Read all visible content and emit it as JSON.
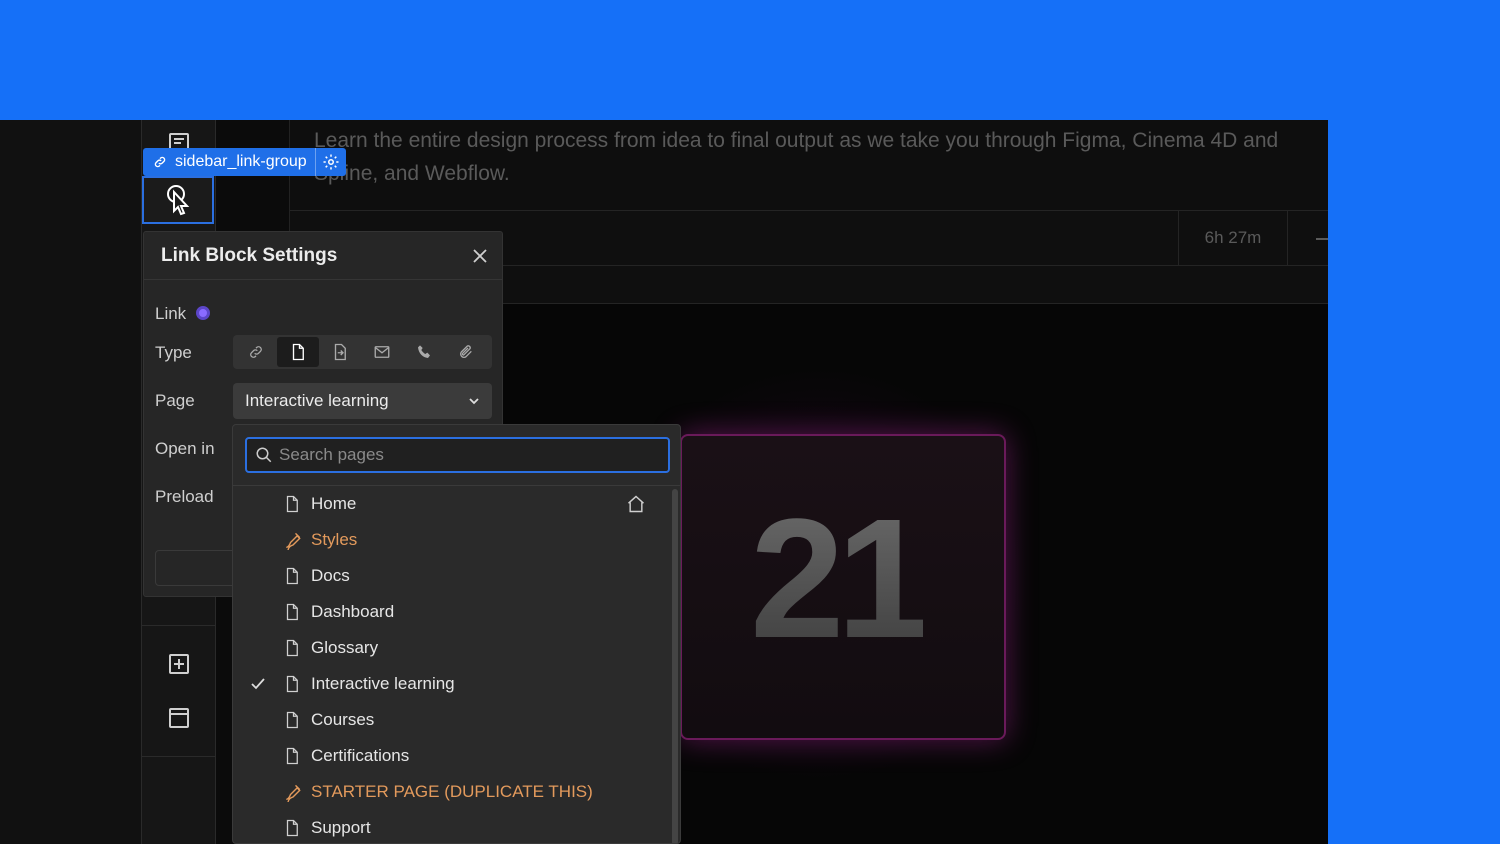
{
  "tag": {
    "label": "sidebar_link-group"
  },
  "canvas": {
    "description_line1": "Learn the entire design process from idea to final output as we take you through Figma, Cinema 4D and",
    "description_line2": "Spline, and Webflow.",
    "duration": "6h 27m",
    "hero_number": "21"
  },
  "panel": {
    "title": "Link Block Settings",
    "link_label": "Link",
    "type_label": "Type",
    "page_label": "Page",
    "open_in_label": "Open in",
    "preload_label": "Preload",
    "type_options": [
      "url-icon",
      "page-icon",
      "section-icon",
      "email-icon",
      "phone-icon",
      "attachment-icon"
    ],
    "type_selected": "page-icon",
    "page_value": "Interactive learning"
  },
  "dropdown": {
    "search_placeholder": "Search pages",
    "pages": [
      {
        "label": "Home",
        "kind": "page",
        "home": true,
        "selected": false
      },
      {
        "label": "Styles",
        "kind": "draft",
        "home": false,
        "selected": false
      },
      {
        "label": "Docs",
        "kind": "page",
        "home": false,
        "selected": false
      },
      {
        "label": "Dashboard",
        "kind": "page",
        "home": false,
        "selected": false
      },
      {
        "label": "Glossary",
        "kind": "page",
        "home": false,
        "selected": false
      },
      {
        "label": "Interactive learning",
        "kind": "page",
        "home": false,
        "selected": true
      },
      {
        "label": "Courses",
        "kind": "page",
        "home": false,
        "selected": false
      },
      {
        "label": "Certifications",
        "kind": "page",
        "home": false,
        "selected": false
      },
      {
        "label": "STARTER PAGE (DUPLICATE THIS)",
        "kind": "draft",
        "home": false,
        "selected": false
      },
      {
        "label": "Support",
        "kind": "page",
        "home": false,
        "selected": false
      }
    ]
  },
  "colors": {
    "background": "#1570f8",
    "accent": "#2b6fe0",
    "draft": "#e39a5c"
  }
}
